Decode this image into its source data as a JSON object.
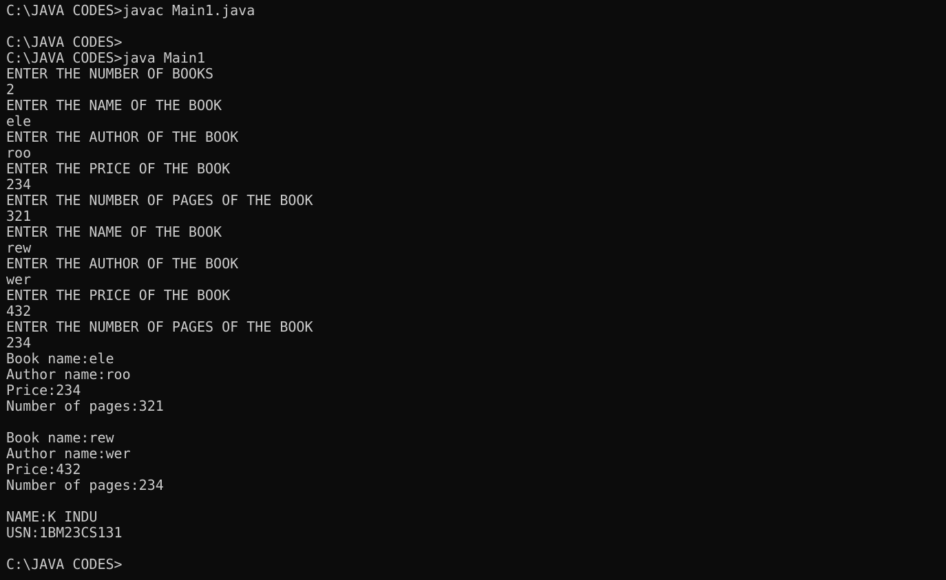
{
  "terminal": {
    "lines": [
      "C:\\JAVA CODES>javac Main1.java",
      "",
      "C:\\JAVA CODES>",
      "C:\\JAVA CODES>java Main1",
      "ENTER THE NUMBER OF BOOKS",
      "2",
      "ENTER THE NAME OF THE BOOK",
      "ele",
      "ENTER THE AUTHOR OF THE BOOK",
      "roo",
      "ENTER THE PRICE OF THE BOOK",
      "234",
      "ENTER THE NUMBER OF PAGES OF THE BOOK",
      "321",
      "ENTER THE NAME OF THE BOOK",
      "rew",
      "ENTER THE AUTHOR OF THE BOOK",
      "wer",
      "ENTER THE PRICE OF THE BOOK",
      "432",
      "ENTER THE NUMBER OF PAGES OF THE BOOK",
      "234",
      "Book name:ele",
      "Author name:roo",
      "Price:234",
      "Number of pages:321",
      "",
      "Book name:rew",
      "Author name:wer",
      "Price:432",
      "Number of pages:234",
      "",
      "NAME:K INDU",
      "USN:1BM23CS131",
      "",
      "C:\\JAVA CODES>"
    ]
  }
}
